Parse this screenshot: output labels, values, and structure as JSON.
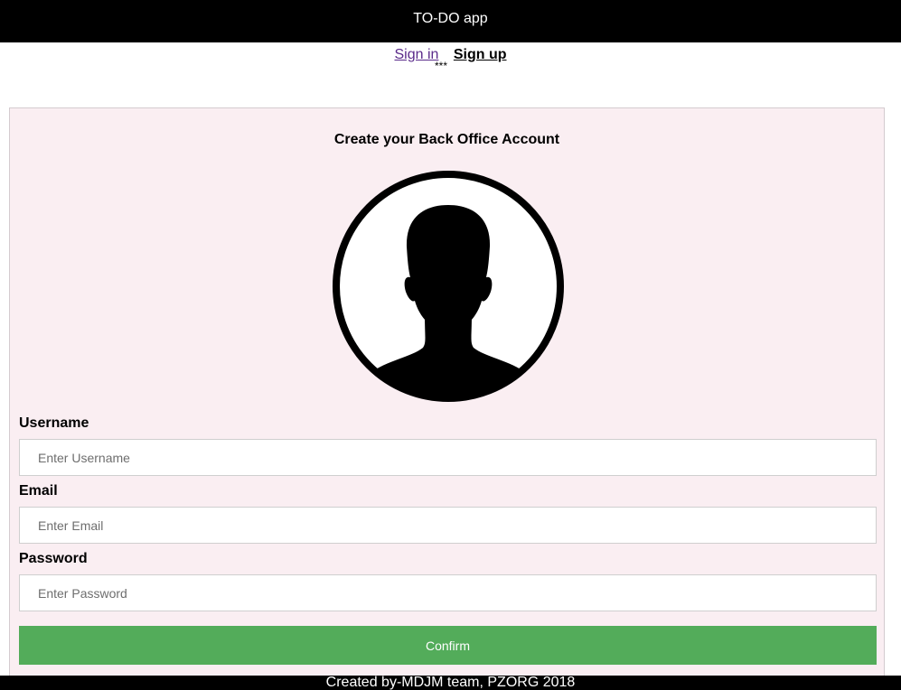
{
  "app": {
    "title": "TO-DO app"
  },
  "nav": {
    "sign_in": "Sign in",
    "sign_up": "Sign up",
    "active_marker": "***"
  },
  "form": {
    "title": "Create your Back Office Account",
    "avatar_icon": "user-silhouette-icon",
    "username": {
      "label": "Username",
      "placeholder": "Enter Username",
      "value": ""
    },
    "email": {
      "label": "Email",
      "placeholder": "Enter Email",
      "value": ""
    },
    "password": {
      "label": "Password",
      "placeholder": "Enter Password",
      "value": ""
    },
    "confirm_label": "Confirm"
  },
  "footer": {
    "text": "Created by-MDJM team, PZORG 2018"
  },
  "colors": {
    "header_bg": "#000000",
    "panel_bg": "#faeef2",
    "confirm_bg": "#53ac5a",
    "sign_in_link": "#5a2a8a"
  }
}
